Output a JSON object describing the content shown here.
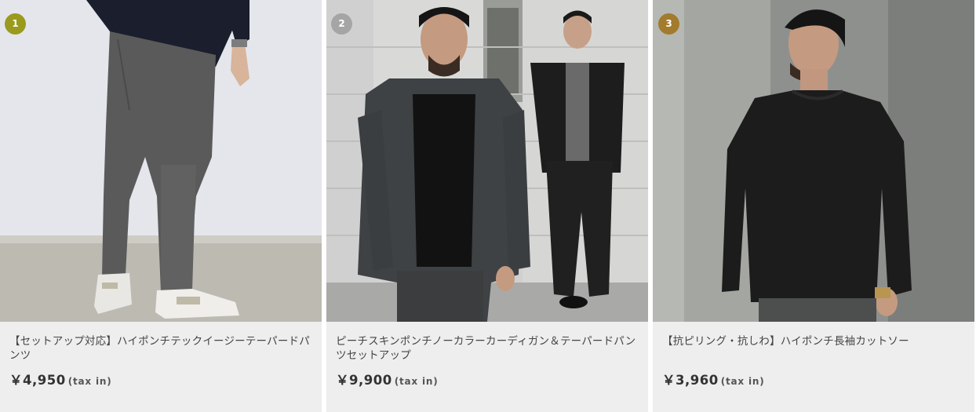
{
  "products": [
    {
      "rank": "1",
      "rank_color": "#9a9a1e",
      "title": "【セットアップ対応】ハイポンチテックイージーテーパードパンツ",
      "price": "￥4,950",
      "tax": "(tax in)"
    },
    {
      "rank": "2",
      "rank_color": "#a5a5a5",
      "title": "ピーチスキンポンチノーカラーカーディガン＆テーパードパンツセットアップ",
      "price": "￥9,900",
      "tax": "(tax in)"
    },
    {
      "rank": "3",
      "rank_color": "#a27b2c",
      "title": "【抗ピリング・抗しわ】ハイポンチ長袖カットソー",
      "price": "￥3,960",
      "tax": "(tax in)"
    }
  ],
  "colors": {
    "card_bg": "#eeeeee",
    "title_text": "#444444",
    "price_text": "#333333"
  }
}
